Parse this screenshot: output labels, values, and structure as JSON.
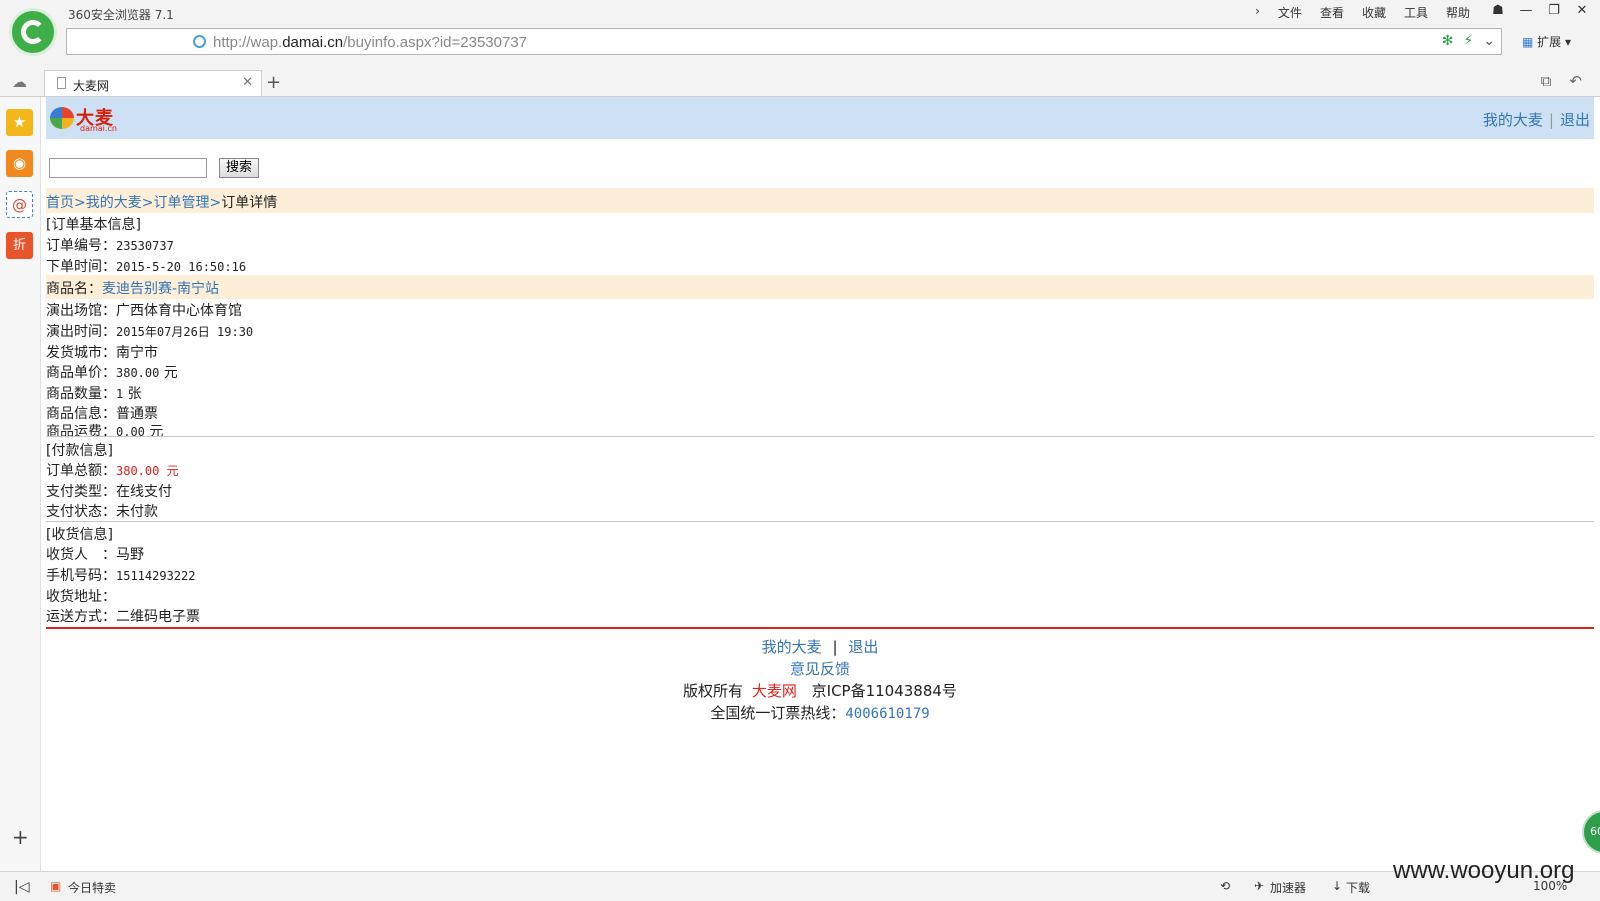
{
  "browser": {
    "app_title": "360安全浏览器 7.1",
    "menu": [
      "文件",
      "查看",
      "收藏",
      "工具",
      "帮助"
    ],
    "url_prefix": "http://wap.",
    "url_domain": "damai.cn",
    "url_suffix": "/buyinfo.aspx?id=23530737",
    "extensions_label": "扩展",
    "tab_title": "大麦网",
    "status_left": "今日特卖",
    "status_accelerator": "加速器",
    "status_download": "下载",
    "zoom": "100%",
    "float_ball": "60"
  },
  "header": {
    "logo_word": "大麦",
    "logo_sub": "damai.cn",
    "my_damai": "我的大麦",
    "separator": "|",
    "logout": "退出"
  },
  "search": {
    "button_label": "搜索",
    "value": ""
  },
  "breadcrumb": {
    "home": "首页",
    "sep": ">",
    "my_damai": "我的大麦",
    "orders": "订单管理",
    "current": "订单详情"
  },
  "order_basic": {
    "section": "[订单基本信息]",
    "order_no_label": "订单编号：",
    "order_no": "23530737",
    "order_time_label": "下单时间：",
    "order_time": "2015-5-20 16:50:16"
  },
  "product": {
    "name_label": "商品名：",
    "name": "麦迪告别赛-南宁站",
    "venue_label": "演出场馆：",
    "venue": "广西体育中心体育馆",
    "show_time_label": "演出时间：",
    "show_time": "2015年07月26日 19:30",
    "city_label": "发货城市：",
    "city": "南宁市",
    "price_label": "商品单价：",
    "price": "380.00",
    "price_unit": " 元",
    "qty_label": "商品数量：",
    "qty": "1",
    "qty_unit": " 张",
    "info_label": "商品信息：",
    "info": "普通票",
    "shipping_label": "商品运费：",
    "shipping": "0.00",
    "shipping_unit": " 元"
  },
  "payment": {
    "section": "[付款信息]",
    "total_label": "订单总额：",
    "total": "380.00 元",
    "type_label": "支付类型：",
    "type": "在线支付",
    "status_label": "支付状态：",
    "status": "未付款"
  },
  "delivery": {
    "section": "[收货信息]",
    "receiver_label": "收货人　：",
    "receiver": "马野",
    "phone_label": "手机号码：",
    "phone": "15114293222",
    "address_label": "收货地址：",
    "method_label": "运送方式：",
    "method": "二维码电子票"
  },
  "footer": {
    "my_damai": "我的大麦",
    "sep": "|",
    "logout": "退出",
    "feedback": "意见反馈",
    "copyright": "版权所有",
    "site": "大麦网",
    "icp": "京ICP备11043884号",
    "hotline_label": "全国统一订票热线：",
    "hotline": "4006610179"
  },
  "watermark": "www.wooyun.org"
}
